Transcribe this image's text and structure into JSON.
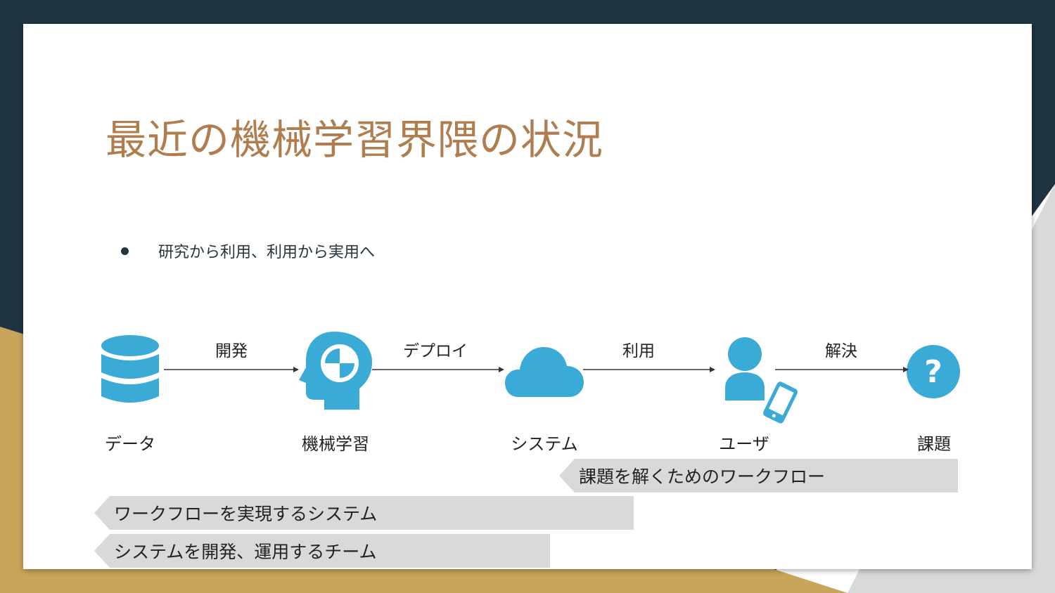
{
  "slide": {
    "title": "最近の機械学習界隈の状況",
    "bullet": "研究から利用、利用から実用へ"
  },
  "flow": {
    "nodes": [
      {
        "label": "データ",
        "icon": "database-icon"
      },
      {
        "label": "機械学習",
        "icon": "ai-head-icon"
      },
      {
        "label": "システム",
        "icon": "cloud-icon"
      },
      {
        "label": "ユーザ",
        "icon": "user-with-phone-icon"
      },
      {
        "label": "課題",
        "icon": "question-icon"
      }
    ],
    "edges": [
      "開発",
      "デプロイ",
      "利用",
      "解決"
    ]
  },
  "banners": [
    "課題を解くためのワークフロー",
    "ワークフローを実現するシステム",
    "システムを開発、運用するチーム"
  ],
  "colors": {
    "title": "#b07d4f",
    "icon": "#3aaad6",
    "dark_bg": "#1f3441",
    "gold_bg": "#c9a55c",
    "light_bg": "#d9d9d9",
    "banner": "#d9d9d9"
  }
}
